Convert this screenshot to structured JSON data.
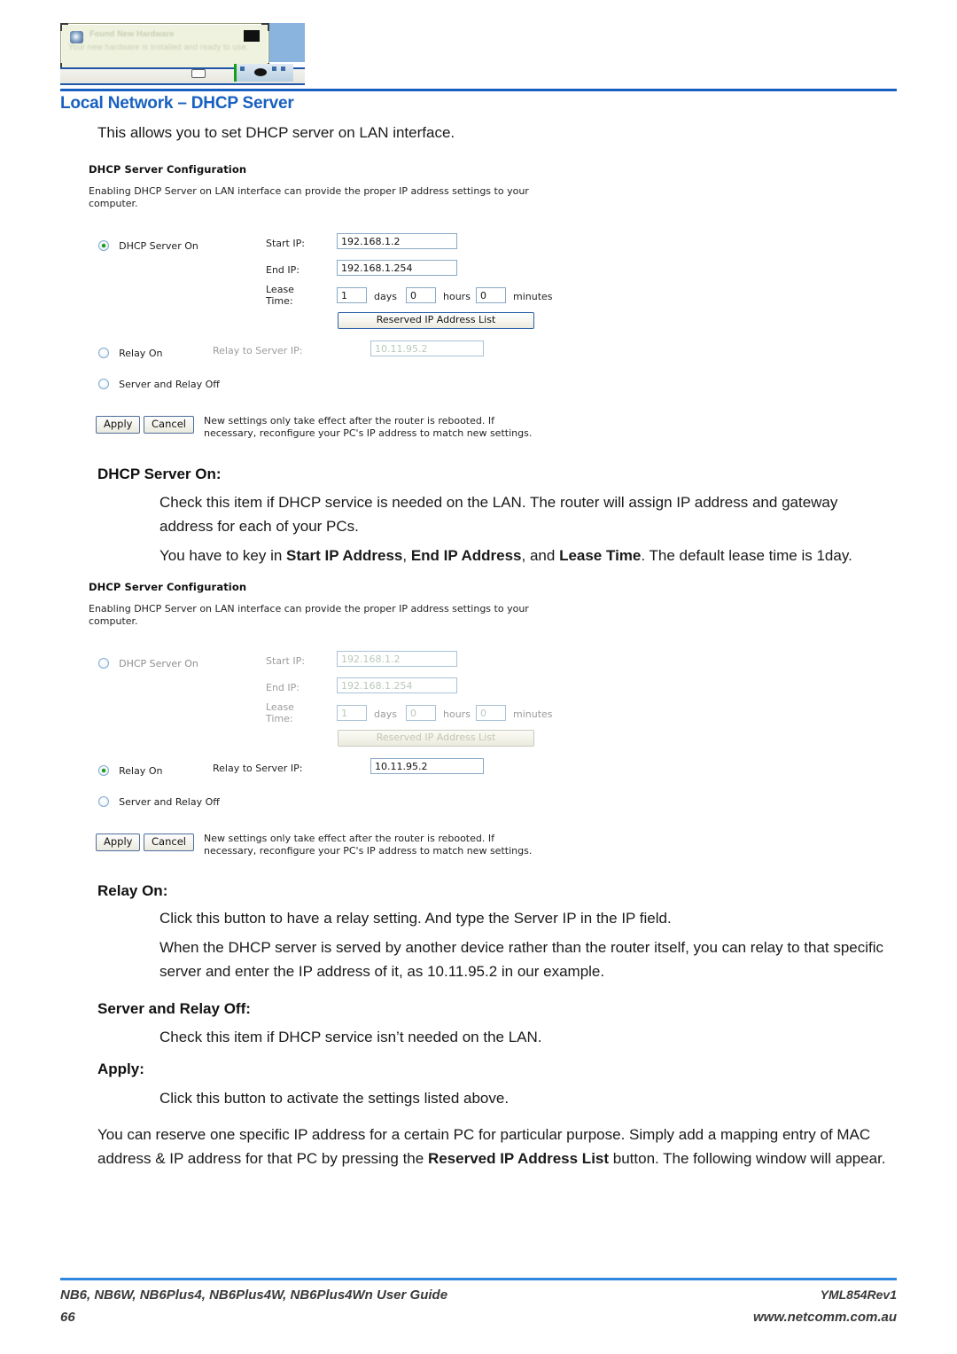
{
  "header": {
    "title": "Local Network – DHCP Server",
    "artifact": {
      "balloon_title": "Found New Hardware",
      "balloon_text": "Your new hardware is installed and ready to use."
    },
    "accent_color": "#1860c0"
  },
  "intro": "This allows you to set DHCP server on LAN interface.",
  "panel1": {
    "title": "DHCP Server Configuration",
    "description": "Enabling DHCP Server on LAN interface can provide the proper IP address settings to your computer.",
    "dhcp_server_on_label": "DHCP Server On",
    "dhcp_server_on_selected": true,
    "start_ip_label": "Start IP:",
    "start_ip_value": "192.168.1.2",
    "end_ip_label": "End IP:",
    "end_ip_value": "192.168.1.254",
    "lease_time_label_1": "Lease",
    "lease_time_label_2": "Time:",
    "lease_days_value": "1",
    "lease_days_unit": "days",
    "lease_hours_value": "0",
    "lease_hours_unit": "hours",
    "lease_minutes_value": "0",
    "lease_minutes_unit": "minutes",
    "reserved_button_label": "Reserved IP Address List",
    "relay_on_label": "Relay On",
    "relay_on_selected": false,
    "relay_server_ip_label": "Relay to Server IP:",
    "relay_server_ip_value": "10.11.95.2",
    "server_relay_off_label": "Server and Relay Off",
    "server_relay_off_selected": false,
    "apply_label": "Apply",
    "cancel_label": "Cancel",
    "apply_note_line1": "New settings only take effect after the router is rebooted. If",
    "apply_note_line2": "necessary, reconfigure your PC's IP address to match new settings."
  },
  "panel2": {
    "title": "DHCP Server Configuration",
    "description": "Enabling DHCP Server on LAN interface can provide the proper IP address settings to your computer.",
    "dhcp_server_on_label": "DHCP Server On",
    "dhcp_server_on_selected": false,
    "start_ip_label": "Start IP:",
    "start_ip_value": "192.168.1.2",
    "end_ip_label": "End IP:",
    "end_ip_value": "192.168.1.254",
    "lease_time_label_1": "Lease",
    "lease_time_label_2": "Time:",
    "lease_days_value": "1",
    "lease_days_unit": "days",
    "lease_hours_value": "0",
    "lease_hours_unit": "hours",
    "lease_minutes_value": "0",
    "lease_minutes_unit": "minutes",
    "reserved_button_label": "Reserved IP Address List",
    "relay_on_label": "Relay On",
    "relay_on_selected": true,
    "relay_server_ip_label": "Relay to Server IP:",
    "relay_server_ip_value": "10.11.95.2",
    "server_relay_off_label": "Server and Relay Off",
    "server_relay_off_selected": false,
    "apply_label": "Apply",
    "cancel_label": "Cancel",
    "apply_note_line1": "New settings only take effect after the router is rebooted. If",
    "apply_note_line2": "necessary, reconfigure your PC's IP address to match new settings."
  },
  "sections": {
    "dhcp_server_on": {
      "heading": "DHCP Server On:",
      "para1": "Check this item if DHCP service is needed on the LAN. The router will assign IP address and gateway address for each of your PCs.",
      "para2_pre": "You have to key in ",
      "para2_b1": "Start IP Address",
      "para2_mid1": ", ",
      "para2_b2": "End IP Address",
      "para2_mid2": ", and ",
      "para2_b3": "Lease Time",
      "para2_post": ". The default lease time is 1day."
    },
    "relay_on": {
      "heading": "Relay On:",
      "para1": "Click this button to have a relay setting. And type the Server IP in the IP field.",
      "para2": "When the DHCP server is served by another device rather than the router itself, you can relay to that specific server and enter the IP address of it, as 10.11.95.2 in our example."
    },
    "server_relay_off": {
      "heading": "Server and Relay Off:",
      "para1": "Check this item if DHCP service isn’t needed on the LAN."
    },
    "apply": {
      "heading": "Apply:",
      "para1": "Click this button to activate the settings listed above."
    },
    "closing": {
      "pre": "You can reserve one specific IP address for a certain PC for particular purpose. Simply add a mapping entry of MAC address & IP address for that PC by pressing the ",
      "bold": "Reserved IP Address List",
      "post": " button. The following window will appear."
    }
  },
  "footer": {
    "guide": "NB6, NB6W, NB6Plus4, NB6Plus4W, NB6Plus4Wn User Guide",
    "page_number": "66",
    "revision": "YML854Rev1",
    "url": "www.netcomm.com.au"
  }
}
